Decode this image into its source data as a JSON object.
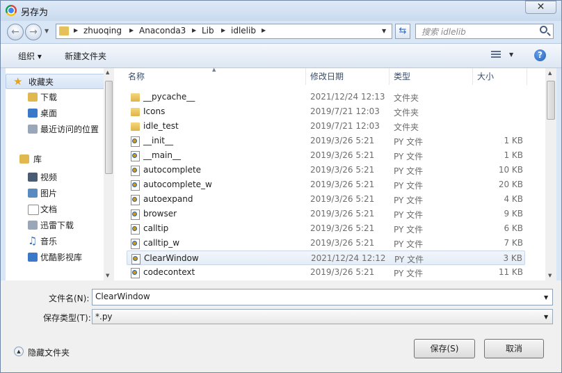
{
  "window": {
    "title": "另存为",
    "close_glyph": "✕"
  },
  "address": {
    "crumbs": [
      "zhuoqing",
      "Anaconda3",
      "Lib",
      "idlelib"
    ],
    "search_placeholder": "搜索 idlelib"
  },
  "toolbar": {
    "organize_label": "组织 ▾",
    "new_folder_label": "新建文件夹",
    "help_glyph": "?"
  },
  "nav_pane": {
    "items": [
      {
        "label": "收藏夹",
        "icon": "star-icon",
        "color": "#e8a317"
      },
      {
        "label": "下载",
        "icon": "download-folder-icon",
        "color": "#e0b84f"
      },
      {
        "label": "桌面",
        "icon": "desktop-icon",
        "color": "#3a78c8"
      },
      {
        "label": "最近访问的位置",
        "icon": "recent-places-icon",
        "color": "#7a8aa0"
      },
      {
        "label": "库",
        "icon": "library-icon",
        "color": "#e0b84f"
      },
      {
        "label": "视频",
        "icon": "video-library-icon",
        "color": "#4a5b74"
      },
      {
        "label": "图片",
        "icon": "pictures-library-icon",
        "color": "#5a8bc0"
      },
      {
        "label": "文档",
        "icon": "documents-library-icon",
        "color": "#9aa7b8"
      },
      {
        "label": "迅雷下载",
        "icon": "thunder-download-icon",
        "color": "#7a8aa0"
      },
      {
        "label": "音乐",
        "icon": "music-library-icon",
        "color": "#2f6fc0"
      },
      {
        "label": "优酷影视库",
        "icon": "youku-library-icon",
        "color": "#3a78c8"
      }
    ]
  },
  "columns": {
    "name": "名称",
    "modified": "修改日期",
    "type": "类型",
    "size": "大小"
  },
  "files": [
    {
      "name": "__pycache__",
      "modified": "2021/12/24 12:13",
      "type": "文件夹",
      "size": "",
      "kind": "folder"
    },
    {
      "name": "Icons",
      "modified": "2019/7/21 12:03",
      "type": "文件夹",
      "size": "",
      "kind": "folder"
    },
    {
      "name": "idle_test",
      "modified": "2019/7/21 12:03",
      "type": "文件夹",
      "size": "",
      "kind": "folder"
    },
    {
      "name": "__init__",
      "modified": "2019/3/26 5:21",
      "type": "PY 文件",
      "size": "1 KB",
      "kind": "py"
    },
    {
      "name": "__main__",
      "modified": "2019/3/26 5:21",
      "type": "PY 文件",
      "size": "1 KB",
      "kind": "py"
    },
    {
      "name": "autocomplete",
      "modified": "2019/3/26 5:21",
      "type": "PY 文件",
      "size": "10 KB",
      "kind": "py"
    },
    {
      "name": "autocomplete_w",
      "modified": "2019/3/26 5:21",
      "type": "PY 文件",
      "size": "20 KB",
      "kind": "py"
    },
    {
      "name": "autoexpand",
      "modified": "2019/3/26 5:21",
      "type": "PY 文件",
      "size": "4 KB",
      "kind": "py"
    },
    {
      "name": "browser",
      "modified": "2019/3/26 5:21",
      "type": "PY 文件",
      "size": "9 KB",
      "kind": "py"
    },
    {
      "name": "calltip",
      "modified": "2019/3/26 5:21",
      "type": "PY 文件",
      "size": "6 KB",
      "kind": "py"
    },
    {
      "name": "calltip_w",
      "modified": "2019/3/26 5:21",
      "type": "PY 文件",
      "size": "7 KB",
      "kind": "py"
    },
    {
      "name": "ClearWindow",
      "modified": "2021/12/24 12:12",
      "type": "PY 文件",
      "size": "3 KB",
      "kind": "py",
      "selected": true
    },
    {
      "name": "codecontext",
      "modified": "2019/3/26 5:21",
      "type": "PY 文件",
      "size": "11 KB",
      "kind": "py"
    }
  ],
  "form": {
    "filename_label": "文件名(N):",
    "filename_value": "ClearWindow",
    "filetype_label": "保存类型(T):",
    "filetype_value": "*.py",
    "hide_folders_label": "隐藏文件夹",
    "save_label": "保存(S)",
    "cancel_label": "取消"
  }
}
